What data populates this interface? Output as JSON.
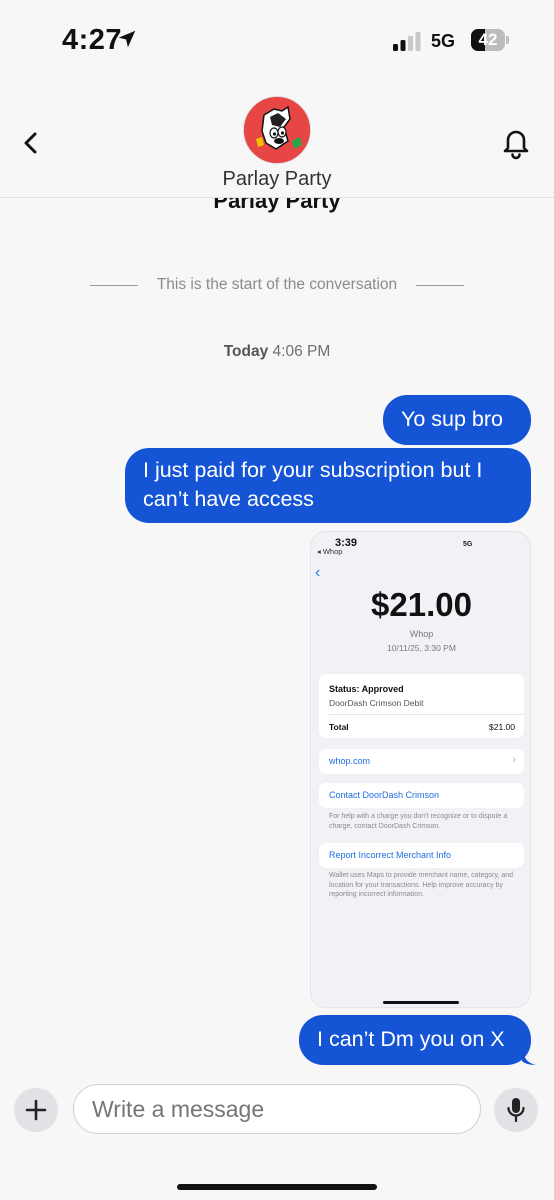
{
  "status_bar": {
    "time": "4:27",
    "network": "5G",
    "battery_level": "42",
    "location_icon": "location-arrow-icon",
    "signal_icon": "cellular-signal-icon"
  },
  "header": {
    "title": "Parlay Party",
    "back_icon": "chevron-left-icon",
    "bell_icon": "bell-icon",
    "avatar_icon": "goofy-avatar-icon"
  },
  "peek_title": "Parlay Party",
  "conversation": {
    "start_text": "This is the start of the conversation",
    "day_label": "Today",
    "time_label": "4:06 PM"
  },
  "messages": [
    {
      "text": "Yo sup bro",
      "sender": "me"
    },
    {
      "text": "I just paid for your subscription but I can’t have access",
      "sender": "me"
    },
    {
      "text": "I can’t Dm you on X",
      "sender": "me"
    }
  ],
  "attachment": {
    "status_time": "3:39",
    "app_label": "◂ Whop",
    "network": "5G",
    "amount": "$21.00",
    "merchant": "Whop",
    "datetime": "10/11/25, 3:30 PM",
    "status": "Status: Approved",
    "payment_method": "DoorDash Crimson Debit",
    "total_label": "Total",
    "total_value": "$21.00",
    "link_site": "whop.com",
    "contact_label": "Contact DoorDash Crimson",
    "contact_note": "For help with a charge you don’t recognize or to dispute a charge, contact DoorDash Crimson.",
    "report_label": "Report Incorrect Merchant Info",
    "report_note": "Wallet uses Maps to provide merchant name, category, and location for your transactions. Help improve accuracy by reporting incorrect information."
  },
  "composer": {
    "placeholder": "Write a message",
    "plus_icon": "plus-icon",
    "mic_icon": "microphone-icon"
  },
  "colors": {
    "bubble": "#1654d6",
    "background": "#f7f7f8",
    "link": "#1f6fe0"
  }
}
